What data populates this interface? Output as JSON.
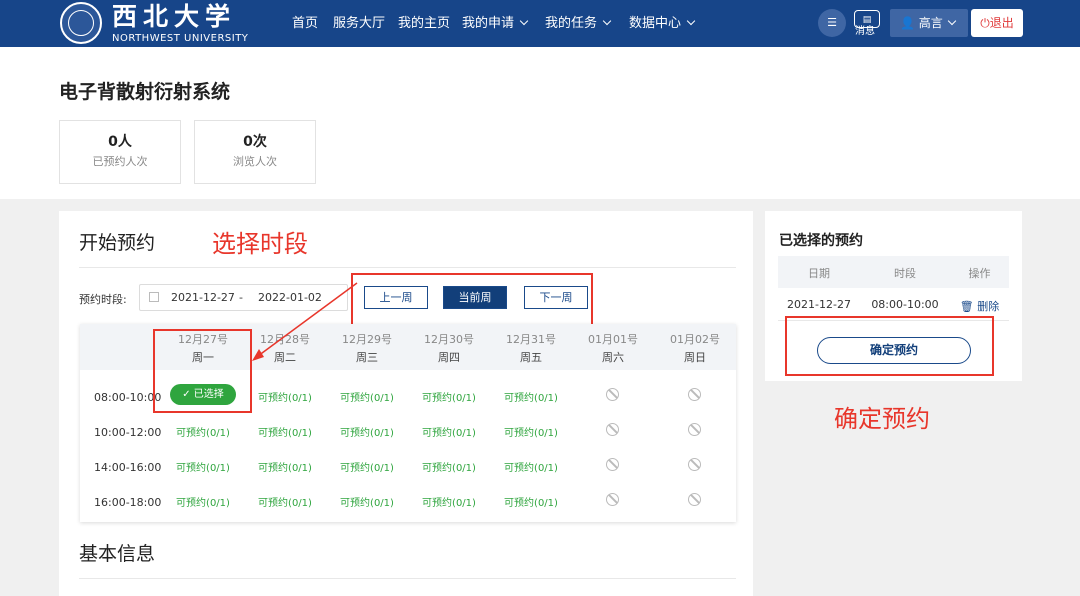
{
  "header": {
    "logo_cn": "西北大学",
    "logo_en": "NORTHWEST UNIVERSITY",
    "nav": [
      {
        "label": "首页"
      },
      {
        "label": "服务大厅"
      },
      {
        "label": "我的主页"
      },
      {
        "label": "我的申请"
      },
      {
        "label": "我的任务"
      },
      {
        "label": "数据中心"
      }
    ],
    "message_label": "消息",
    "user_name": "高言",
    "logout_label": "退出"
  },
  "system": {
    "title": "电子背散射衍射系统",
    "stats": [
      {
        "value": "0人",
        "label": "已预约人次"
      },
      {
        "value": "0次",
        "label": "浏览人次"
      }
    ]
  },
  "booking": {
    "title": "开始预约",
    "annotation_select": "选择时段",
    "range_label": "预约时段:",
    "range_start": "2021-12-27",
    "range_sep": "-",
    "range_end": "2022-01-02",
    "prev_week": "上一周",
    "current_week": "当前周",
    "next_week": "下一周",
    "days": [
      {
        "date": "12月27号",
        "name": "周一"
      },
      {
        "date": "12月28号",
        "name": "周二"
      },
      {
        "date": "12月29号",
        "name": "周三"
      },
      {
        "date": "12月30号",
        "name": "周四"
      },
      {
        "date": "12月31号",
        "name": "周五"
      },
      {
        "date": "01月01号",
        "name": "周六"
      },
      {
        "date": "01月02号",
        "name": "周日"
      }
    ],
    "times": [
      "08:00-10:00",
      "10:00-12:00",
      "14:00-16:00",
      "16:00-18:00"
    ],
    "available_label": "可预约(0/1)",
    "selected_label": "✓ 已选择"
  },
  "basic_info": {
    "title": "基本信息"
  },
  "selected": {
    "title": "已选择的预约",
    "col_date": "日期",
    "col_time": "时段",
    "col_action": "操作",
    "row_date": "2021-12-27",
    "row_time": "08:00-10:00",
    "delete_label": "删除",
    "confirm_label": "确定预约",
    "annotation_confirm": "确定预约"
  },
  "colors": {
    "header_bg": "#174589",
    "available_green": "#2fa53e",
    "annotation_red": "#e8362b",
    "primary_blue": "#123f7a"
  }
}
